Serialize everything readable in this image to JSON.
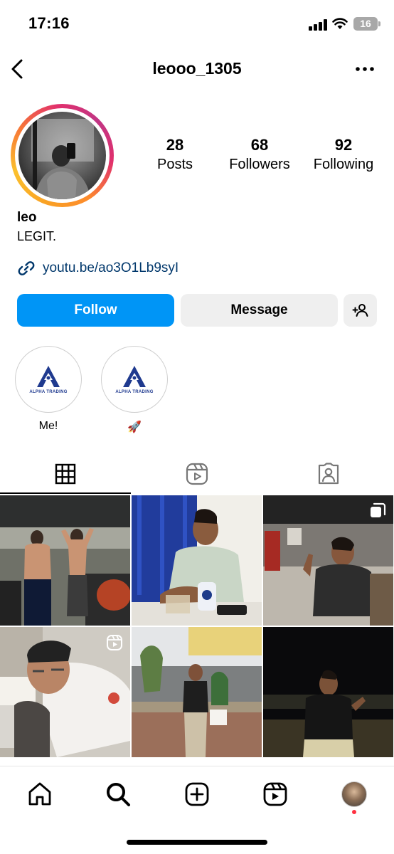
{
  "status_bar": {
    "time": "17:16",
    "battery": "16"
  },
  "header": {
    "username": "leooo_1305"
  },
  "profile": {
    "posts_count": "28",
    "posts_label": "Posts",
    "followers_count": "68",
    "followers_label": "Followers",
    "following_count": "92",
    "following_label": "Following",
    "name": "leo",
    "bio": "LEGIT.",
    "link": "youtu.be/ao3O1Lb9syI"
  },
  "actions": {
    "follow": "Follow",
    "message": "Message"
  },
  "highlights": [
    {
      "label": "Me!",
      "logo_text": "ALPHA TRADING"
    },
    {
      "label": "🚀",
      "logo_text": "ALPHA TRADING"
    }
  ],
  "tabs": [
    "grid",
    "reels",
    "tagged"
  ],
  "colors": {
    "follow_blue": "#0095f6",
    "link_blue": "#00376b",
    "button_gray": "#efefef",
    "notification_red": "#ff3040"
  },
  "grid_posts": [
    {
      "type": "photo"
    },
    {
      "type": "photo"
    },
    {
      "type": "carousel"
    },
    {
      "type": "reel"
    },
    {
      "type": "photo"
    },
    {
      "type": "photo"
    }
  ],
  "bottom_nav": [
    "home-icon",
    "search-icon",
    "create-icon",
    "reels-icon",
    "profile-avatar"
  ]
}
